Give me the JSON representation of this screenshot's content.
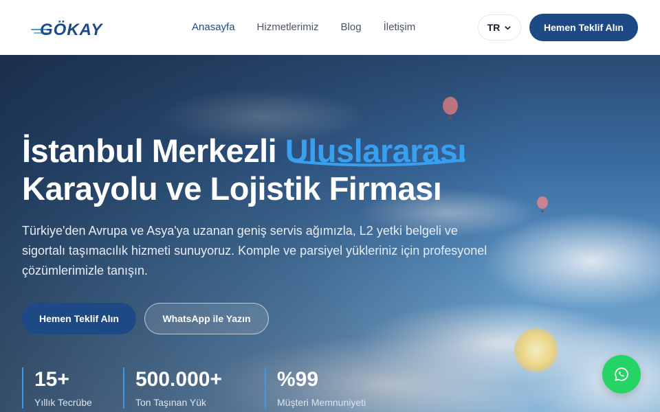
{
  "header": {
    "logo_text": "GÖKAY",
    "nav": [
      {
        "label": "Anasayfa",
        "active": true
      },
      {
        "label": "Hizmetlerimiz",
        "active": false
      },
      {
        "label": "Blog",
        "active": false
      },
      {
        "label": "İletişim",
        "active": false
      }
    ],
    "language": "TR",
    "cta_label": "Hemen Teklif Alın"
  },
  "hero": {
    "title_part1": "İstanbul Merkezli ",
    "title_highlight": "Uluslararası",
    "title_part2": "Karayolu ve Lojistik Firması",
    "description": "Türkiye'den Avrupa ve Asya'ya uzanan geniş servis ağımızla, L2 yetki belgeli ve sigortalı taşımacılık hizmeti sunuyoruz. Komple ve parsiyel yükleriniz için profesyonel çözümlerimizle tanışın.",
    "primary_button": "Hemen Teklif Alın",
    "secondary_button": "WhatsApp ile Yazın",
    "stats": [
      {
        "value": "15+",
        "label": "Yıllık Tecrübe"
      },
      {
        "value": "500.000+",
        "label": "Ton Taşınan Yük"
      },
      {
        "value": "%99",
        "label": "Müşteri Memnuniyeti"
      }
    ]
  },
  "colors": {
    "brand": "#1d4a85",
    "highlight": "#38a0f0",
    "whatsapp": "#25d366"
  },
  "icons": {
    "language_chevron": "chevron-down-icon",
    "floating_button": "whatsapp-icon"
  }
}
